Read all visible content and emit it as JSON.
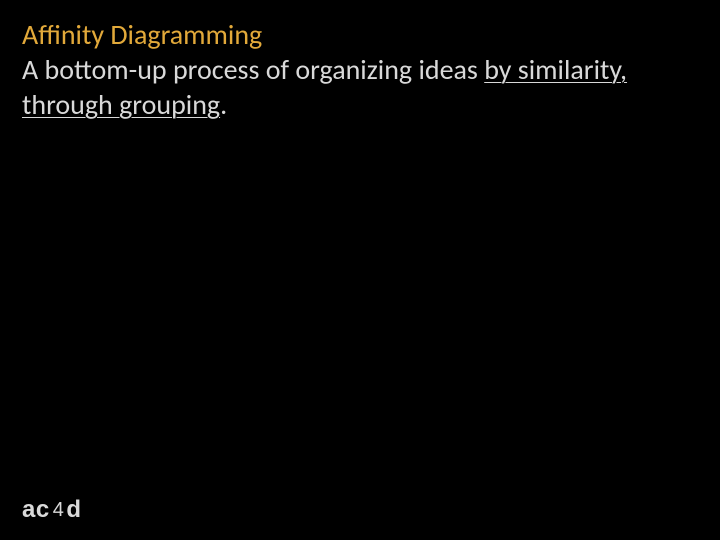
{
  "slide": {
    "title": "Affinity Diagramming",
    "subtitle_part1": "A bottom-up process of organizing ideas ",
    "subtitle_underlined": "by similarity, through grouping",
    "subtitle_part2": "."
  },
  "logo": {
    "part1": "ac",
    "part2": "4",
    "part3": "d"
  },
  "colors": {
    "background": "#000000",
    "title": "#e2a93a",
    "body": "#d9d9d9"
  }
}
